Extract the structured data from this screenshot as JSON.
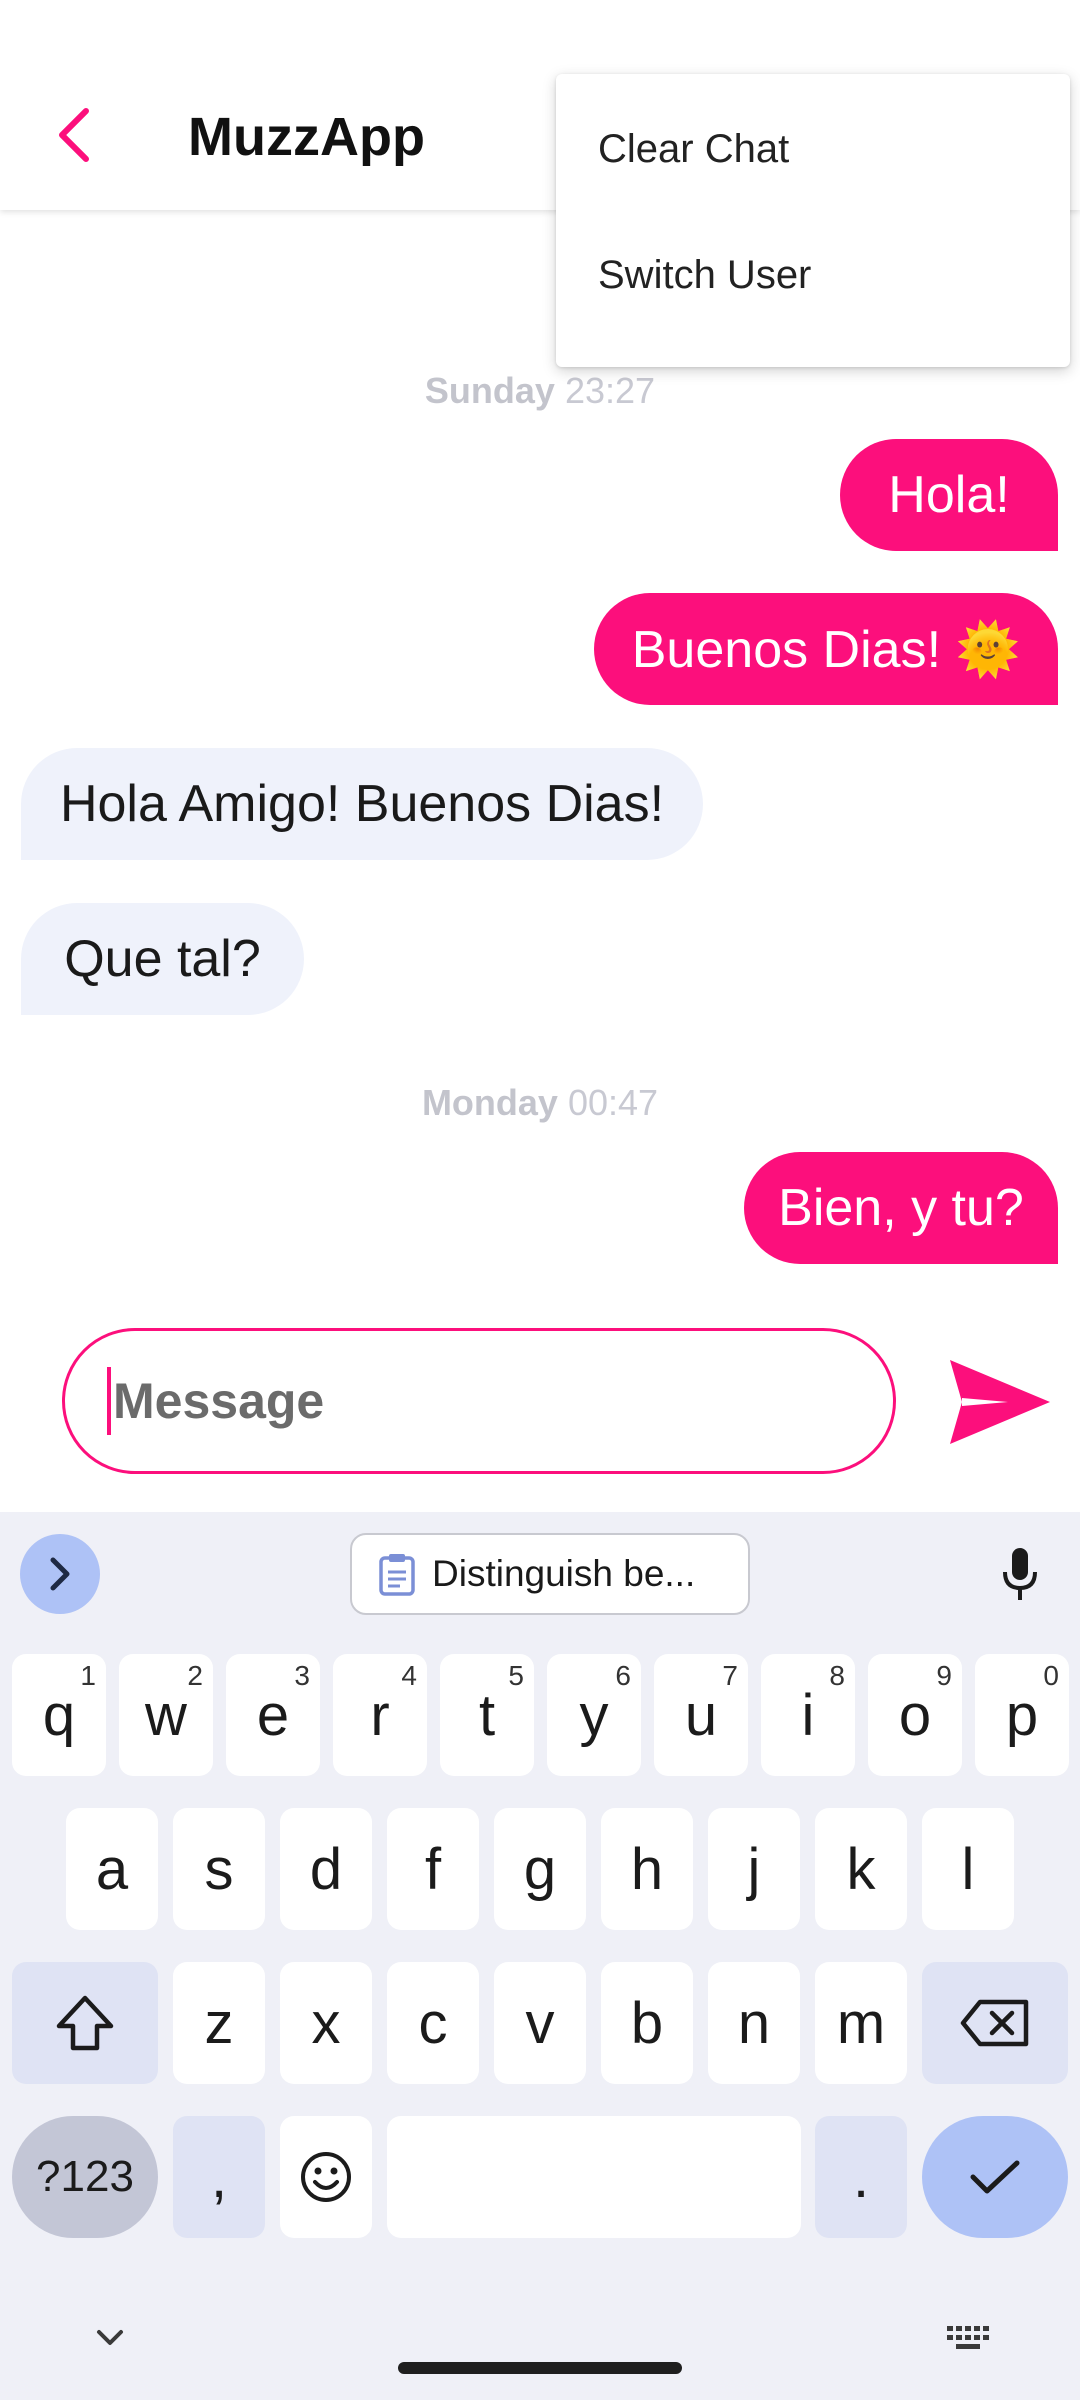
{
  "app": {
    "title": "MuzzApp",
    "accent": "#fc0f7c"
  },
  "menu": {
    "items": [
      "Clear Chat",
      "Switch User"
    ]
  },
  "chat": {
    "sections": [
      {
        "day": "Sunday",
        "time": "23:27"
      },
      {
        "day": "Monday",
        "time": "00:47"
      }
    ],
    "messages": [
      {
        "text": "Hola!",
        "from": "me"
      },
      {
        "text": "Buenos Dias! 🌞",
        "from": "me"
      },
      {
        "text": "Hola Amigo! Buenos Dias!",
        "from": "other"
      },
      {
        "text": "Que tal?",
        "from": "other"
      },
      {
        "text": "Bien, y tu?",
        "from": "me"
      }
    ]
  },
  "composer": {
    "placeholder": "Message",
    "value": ""
  },
  "keyboard": {
    "clipboard_chip": "Distinguish be...",
    "row1": [
      {
        "key": "q",
        "hint": "1"
      },
      {
        "key": "w",
        "hint": "2"
      },
      {
        "key": "e",
        "hint": "3"
      },
      {
        "key": "r",
        "hint": "4"
      },
      {
        "key": "t",
        "hint": "5"
      },
      {
        "key": "y",
        "hint": "6"
      },
      {
        "key": "u",
        "hint": "7"
      },
      {
        "key": "i",
        "hint": "8"
      },
      {
        "key": "o",
        "hint": "9"
      },
      {
        "key": "p",
        "hint": "0"
      }
    ],
    "row2": [
      "a",
      "s",
      "d",
      "f",
      "g",
      "h",
      "j",
      "k",
      "l"
    ],
    "row3": [
      "z",
      "x",
      "c",
      "v",
      "b",
      "n",
      "m"
    ],
    "symbols_label": "?123",
    "comma": ",",
    "period": "."
  }
}
